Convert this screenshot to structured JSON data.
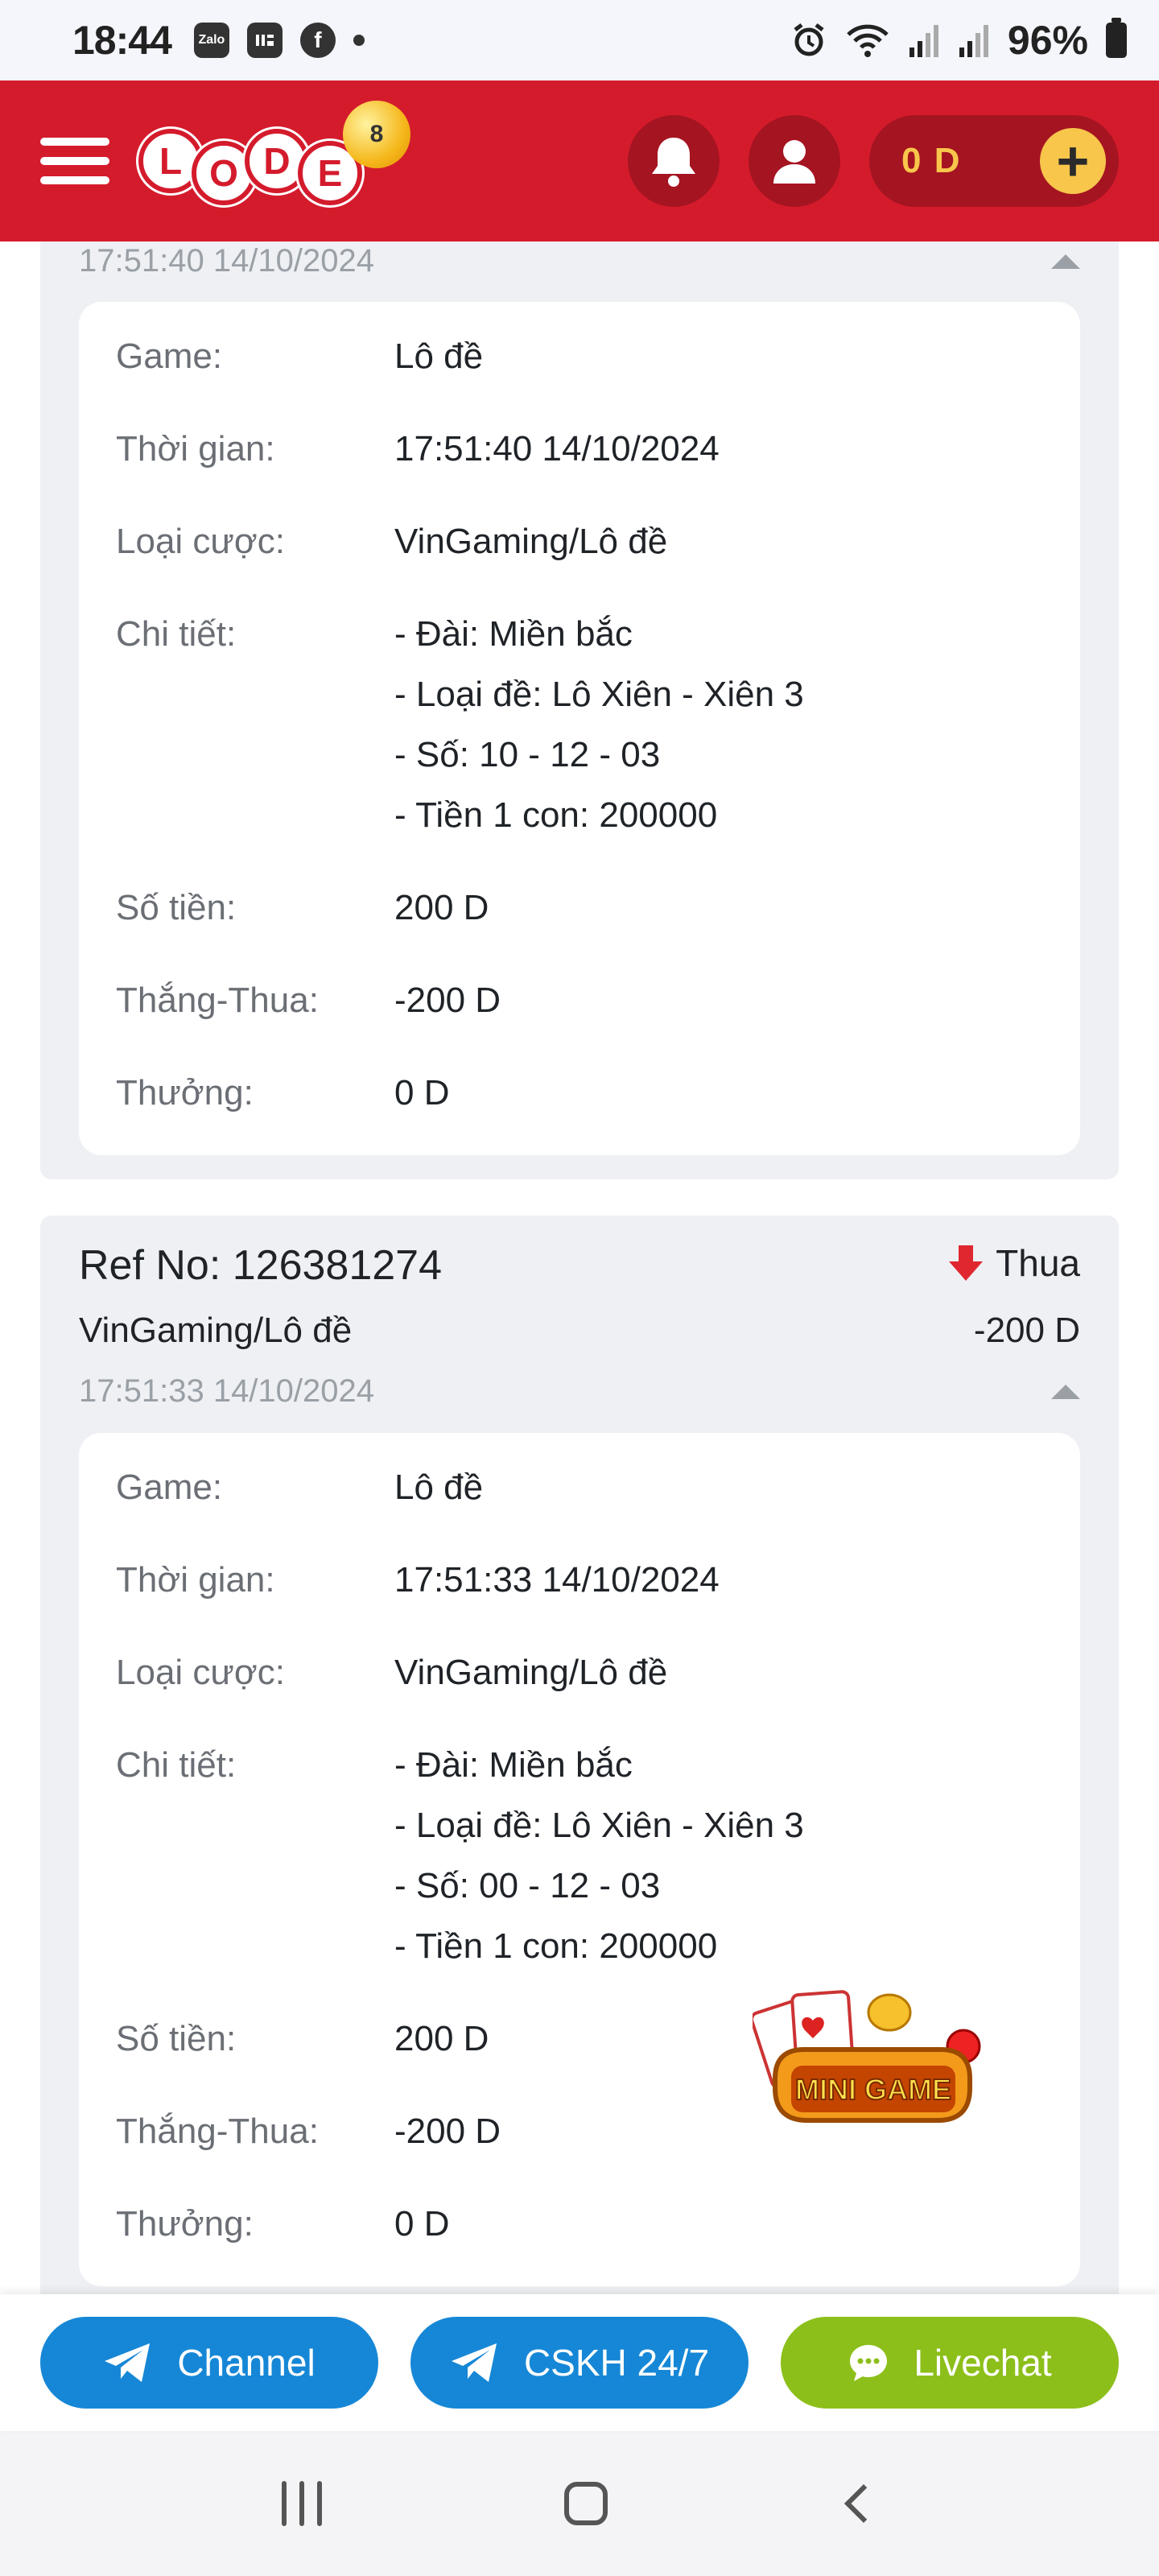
{
  "status_bar": {
    "time": "18:44",
    "left_icons": [
      "zalo-icon",
      "messenger-icon",
      "facebook-icon",
      "dot"
    ],
    "zalo_label": "Zalo",
    "battery": "96%"
  },
  "header": {
    "logo_letters": [
      "L",
      "O",
      "D",
      "E"
    ],
    "logo_ball_number": "8",
    "balance": "0 D",
    "colors": {
      "brand_red": "#d41b2c",
      "accent_gold": "#f7c64b"
    }
  },
  "transactions": [
    {
      "ref_no": "",
      "status": "",
      "bet_type": "",
      "amount": "",
      "timestamp": "17:51:40 14/10/2024",
      "details": {
        "game_label": "Game:",
        "game": "Lô đề",
        "time_label": "Thời gian:",
        "time": "17:51:40 14/10/2024",
        "type_label": "Loại cược:",
        "type": "VinGaming/Lô đề",
        "detail_label": "Chi tiết:",
        "detail_lines": [
          "- Đài: Miền bắc",
          "- Loại đề: Lô Xiên - Xiên 3",
          "- Số: 10 - 12 - 03",
          "- Tiền 1 con: 200000"
        ],
        "stake_label": "Số tiền:",
        "stake": "200 D",
        "winloss_label": "Thắng-Thua:",
        "winloss": "-200 D",
        "reward_label": "Thưởng:",
        "reward": "0 D"
      }
    },
    {
      "ref_no": "Ref No: 126381274",
      "status": "Thua",
      "bet_type": "VinGaming/Lô đề",
      "amount": "-200 D",
      "timestamp": "17:51:33 14/10/2024",
      "details": {
        "game_label": "Game:",
        "game": "Lô đề",
        "time_label": "Thời gian:",
        "time": "17:51:33 14/10/2024",
        "type_label": "Loại cược:",
        "type": "VinGaming/Lô đề",
        "detail_label": "Chi tiết:",
        "detail_lines": [
          "- Đài: Miền bắc",
          "- Loại đề: Lô Xiên - Xiên 3",
          "- Số: 00 - 12 - 03",
          "- Tiền 1 con: 200000"
        ],
        "stake_label": "Số tiền:",
        "stake": "200 D",
        "winloss_label": "Thắng-Thua:",
        "winloss": "-200 D",
        "reward_label": "Thưởng:",
        "reward": "0 D"
      }
    }
  ],
  "minigame_badge": {
    "text": "MINI GAME"
  },
  "bottom_actions": [
    {
      "label": "Channel",
      "icon": "telegram-icon",
      "color": "#1687d6"
    },
    {
      "label": "CSKH 24/7",
      "icon": "telegram-icon",
      "color": "#1687d6"
    },
    {
      "label": "Livechat",
      "icon": "chat-bubble-icon",
      "color": "#8cbf1a"
    }
  ]
}
